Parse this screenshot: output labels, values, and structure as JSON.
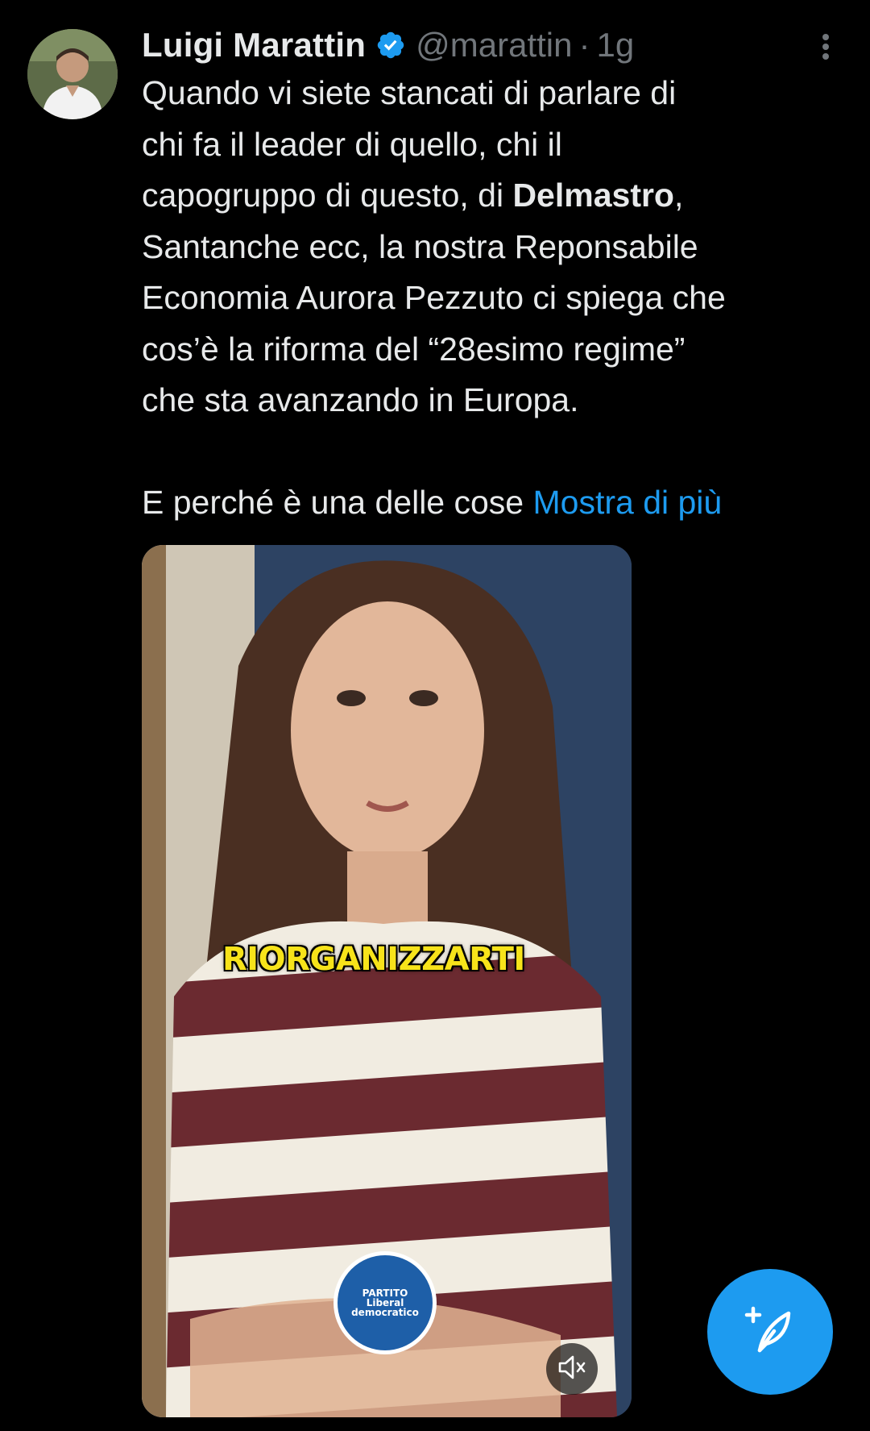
{
  "tweet": {
    "author_name": "Luigi Marattin",
    "handle": "@marattin",
    "separator": "·",
    "time": "1g",
    "text_lines": [
      "Quando vi siete stancati di parlare di",
      "chi fa il leader di quello, chi il"
    ],
    "line3_prefix": "capogruppo di questo, di ",
    "line3_bold": "Delmastro",
    "line3_suffix": ",",
    "text_lines_2": [
      "Santanche ecc, la nostra Reponsabile",
      "Economia Aurora Pezzuto ci spiega che",
      "cos’è la riforma del “28esimo regime”",
      "che sta avanzando in Europa."
    ],
    "last_line_prefix": "E perché è una delle cose ",
    "show_more": "Mostra di più"
  },
  "media": {
    "caption": "RIORGANIZZARTI",
    "party_logo": {
      "line1": "PARTITO",
      "line2": "Liberal",
      "line3": "democratico"
    }
  },
  "icons": {
    "verified": "verified-badge-icon",
    "more": "more-vertical-icon",
    "mute": "volume-muted-icon",
    "compose": "compose-tweet-icon"
  },
  "colors": {
    "accent": "#1d9bf0",
    "background": "#000000",
    "text": "#e7e9ea",
    "secondary_text": "#71767b",
    "caption": "#f7e31a"
  }
}
